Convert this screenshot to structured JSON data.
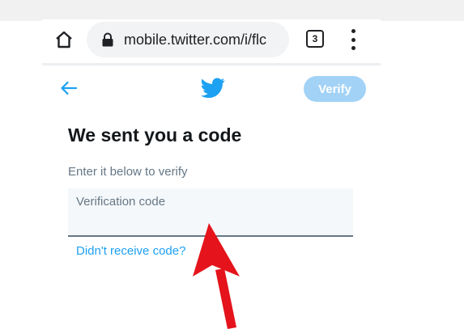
{
  "browser": {
    "url": "mobile.twitter.com/i/flc",
    "tab_count": "3"
  },
  "header": {
    "verify_label": "Verify"
  },
  "main": {
    "title": "We sent you a code",
    "subtitle": "Enter it below to verify",
    "code_placeholder": "Verification code",
    "resend_link": "Didn't receive code?"
  },
  "icons": {
    "home": "home-icon",
    "lock": "lock-icon",
    "menu": "more-vert-icon",
    "back": "back-arrow-icon",
    "logo": "twitter-bird-icon",
    "annotation": "red-arrow-annotation"
  },
  "colors": {
    "twitter_blue": "#1da1f2",
    "verify_disabled": "#a2d2f6",
    "annotation_red": "#e5131b"
  }
}
